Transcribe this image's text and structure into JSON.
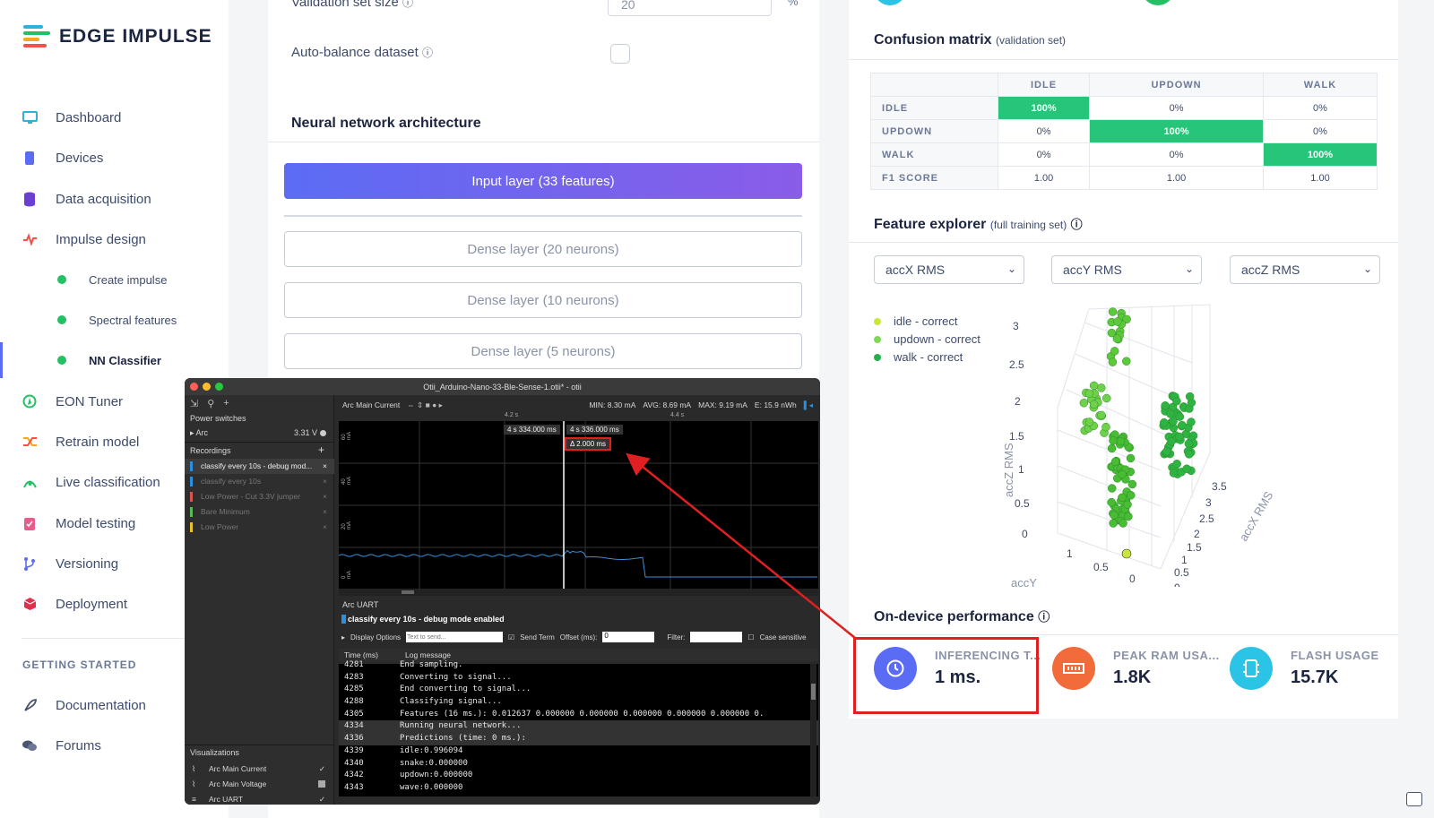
{
  "brand": {
    "name": "EDGE IMPULSE"
  },
  "sidebar": {
    "items": [
      {
        "label": "Dashboard",
        "icon": "monitor-icon",
        "color": "#2bb4d6"
      },
      {
        "label": "Devices",
        "icon": "chip-icon",
        "color": "#5b6cf4"
      },
      {
        "label": "Data acquisition",
        "icon": "database-icon",
        "color": "#6a3fd1"
      },
      {
        "label": "Impulse design",
        "icon": "pulse-icon",
        "color": "#f0524a"
      },
      {
        "label": "Create impulse",
        "icon": "dot-icon"
      },
      {
        "label": "Spectral features",
        "icon": "dot-icon"
      },
      {
        "label": "NN Classifier",
        "icon": "dot-icon"
      },
      {
        "label": "EON Tuner",
        "icon": "compass-icon",
        "color": "#24c063"
      },
      {
        "label": "Retrain model",
        "icon": "shuffle-icon",
        "color": "#f5a623"
      },
      {
        "label": "Live classification",
        "icon": "signal-icon",
        "color": "#24c063"
      },
      {
        "label": "Model testing",
        "icon": "clipboard-check-icon",
        "color": "#e85b8a"
      },
      {
        "label": "Versioning",
        "icon": "branch-icon",
        "color": "#5b6cf4"
      },
      {
        "label": "Deployment",
        "icon": "box-icon",
        "color": "#e0304a"
      }
    ],
    "section_title": "GETTING STARTED",
    "getting_started": [
      {
        "label": "Documentation",
        "icon": "rocket-icon"
      },
      {
        "label": "Forums",
        "icon": "chat-icon"
      }
    ]
  },
  "training": {
    "validation_label": "Validation set size",
    "validation_value": "20",
    "validation_unit": "%",
    "auto_balance_label": "Auto-balance dataset",
    "nn_title": "Neural network architecture",
    "input_layer": "Input layer (33 features)",
    "dense_layers": [
      "Dense layer (20 neurons)",
      "Dense layer (10 neurons)",
      "Dense layer (5 neurons)"
    ]
  },
  "confusion": {
    "title": "Confusion matrix",
    "subtitle": "(validation set)",
    "columns": [
      "IDLE",
      "UPDOWN",
      "WALK"
    ],
    "rows": [
      {
        "label": "IDLE",
        "cells": [
          "100%",
          "0%",
          "0%"
        ]
      },
      {
        "label": "UPDOWN",
        "cells": [
          "0%",
          "100%",
          "0%"
        ]
      },
      {
        "label": "WALK",
        "cells": [
          "0%",
          "0%",
          "100%"
        ]
      },
      {
        "label": "F1 SCORE",
        "cells": [
          "1.00",
          "1.00",
          "1.00"
        ]
      }
    ]
  },
  "explorer": {
    "title": "Feature explorer",
    "subtitle": "(full training set)",
    "selects": [
      "accX RMS",
      "accY RMS",
      "accZ RMS"
    ],
    "legend": [
      {
        "label": "idle - correct",
        "color": "#c8e63c"
      },
      {
        "label": "updown - correct",
        "color": "#7ed957"
      },
      {
        "label": "walk - correct",
        "color": "#27b14a"
      }
    ],
    "z_axis_label": "accZ RMS",
    "x_axis_label": "accX RMS",
    "y_axis_label_partial": "accY",
    "z_ticks": [
      "3",
      "2.5",
      "2",
      "1.5",
      "1",
      "0.5",
      "0"
    ],
    "x_ticks": [
      "3.5",
      "3",
      "2.5",
      "2",
      "1.5",
      "1",
      "0.5",
      "0"
    ],
    "y_ticks": [
      "1",
      "0.5",
      "0"
    ]
  },
  "performance": {
    "title": "On-device performance",
    "metrics": [
      {
        "label": "INFERENCING T...",
        "value": "1 ms.",
        "color": "#5b6cf4",
        "icon": "clock-icon"
      },
      {
        "label": "PEAK RAM USA...",
        "value": "1.8K",
        "color": "#f26b3a",
        "icon": "ram-icon"
      },
      {
        "label": "FLASH USAGE",
        "value": "15.7K",
        "color": "#2bc4e6",
        "icon": "flash-chip-icon"
      }
    ]
  },
  "otii": {
    "title": "Otii_Arduino-Nano-33-Ble-Sense-1.otii* - otii",
    "power_switches": "Power switches",
    "arc_label": "Arc",
    "arc_voltage": "3.31 V",
    "recordings_title": "Recordings",
    "recordings": [
      {
        "label": "classify every 10s - debug mod...",
        "color": "#2b8fe0",
        "active": true
      },
      {
        "label": "classify every 10s",
        "color": "#2b8fe0",
        "active": false
      },
      {
        "label": "Low Power - Cut 3.3V jumper",
        "color": "#d9534f",
        "active": false
      },
      {
        "label": "Bare Minimum",
        "color": "#5cb85c",
        "active": false
      },
      {
        "label": "Low Power",
        "color": "#e6c229",
        "active": false
      }
    ],
    "visualizations_title": "Visualizations",
    "visualizations": [
      "Arc Main Current",
      "Arc Main Voltage",
      "Arc UART"
    ],
    "channel": "Arc Main Current",
    "stats": {
      "min": "MIN: 8.30 mA",
      "avg": "AVG: 8.69 mA",
      "max": "MAX: 9.19 mA",
      "energy": "E: 15.9 nWh"
    },
    "time_ticks": [
      "4.2 s",
      "4.4 s"
    ],
    "cursor_a": "4 s 334.000 ms",
    "cursor_b": "4 s 336.000 ms",
    "delta": "Δ 2.000 ms",
    "y_ticks": [
      "60 mA",
      "40 mA",
      "20 mA",
      "0 mA"
    ],
    "uart_title": "Arc UART",
    "uart_recording": "classify every 10s - debug mode enabled",
    "display_options": "Display Options",
    "send_placeholder": "Text to send...",
    "send_term": "Send Term",
    "offset_label": "Offset (ms):",
    "offset_value": "0",
    "filter_label": "Filter:",
    "case_sensitive": "Case sensitive",
    "col_time": "Time (ms)",
    "col_msg": "Log message",
    "log": [
      {
        "t": "4281",
        "m": "End sampling."
      },
      {
        "t": "4283",
        "m": "Converting to signal..."
      },
      {
        "t": "4285",
        "m": "End converting to signal..."
      },
      {
        "t": "4288",
        "m": "Classifying signal..."
      },
      {
        "t": "4305",
        "m": "Features (16 ms.): 0.012637 0.000000 0.000000 0.000000 0.000000 0.000000 0."
      },
      {
        "t": "4334",
        "m": "Running neural network..."
      },
      {
        "t": "4336",
        "m": "Predictions (time: 0 ms.):"
      },
      {
        "t": "4339",
        "m": "idle:0.996094"
      },
      {
        "t": "4340",
        "m": "snake:0.000000"
      },
      {
        "t": "4342",
        "m": "updown:0.000000"
      },
      {
        "t": "4343",
        "m": "wave:0.000000"
      }
    ]
  }
}
